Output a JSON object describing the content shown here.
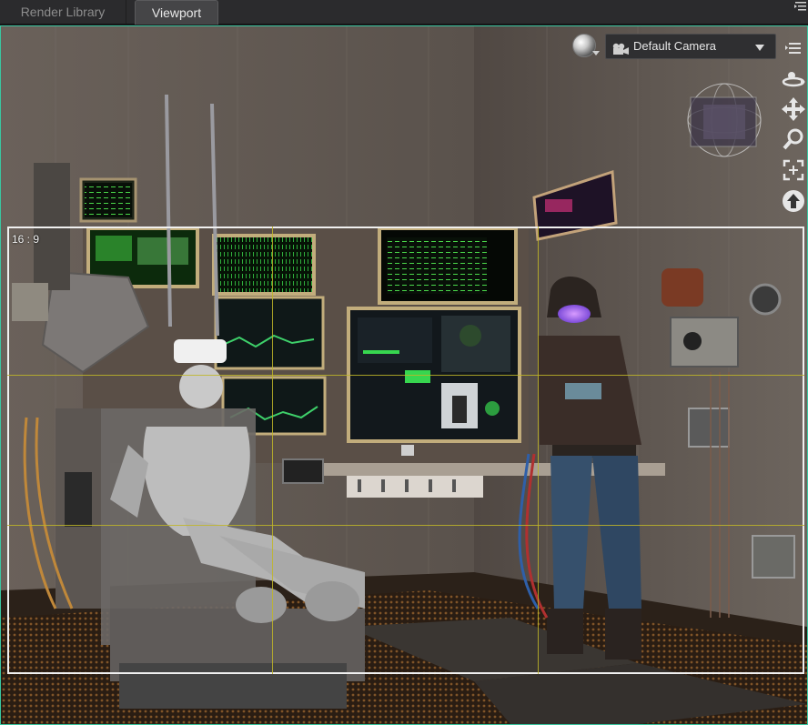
{
  "tabs": [
    {
      "label": "Render Library",
      "active": false
    },
    {
      "label": "Viewport",
      "active": true
    }
  ],
  "tab_menu_icon": "list-menu-icon",
  "viewport": {
    "camera_select": {
      "value": "Default Camera",
      "icon": "video-camera-icon"
    },
    "shading_control_icon": "shading-sphere-icon",
    "side_tools": [
      {
        "name": "orbit-icon"
      },
      {
        "name": "pan-move-icon"
      },
      {
        "name": "zoom-magnifier-icon"
      },
      {
        "name": "frame-fit-icon"
      },
      {
        "name": "reset-up-icon"
      }
    ],
    "render_frame": {
      "aspect_label": "16 : 9"
    },
    "colors": {
      "active_border": "#39c6a0",
      "guide_lines": "#bfb628",
      "frame": "#f0f0f0"
    }
  }
}
